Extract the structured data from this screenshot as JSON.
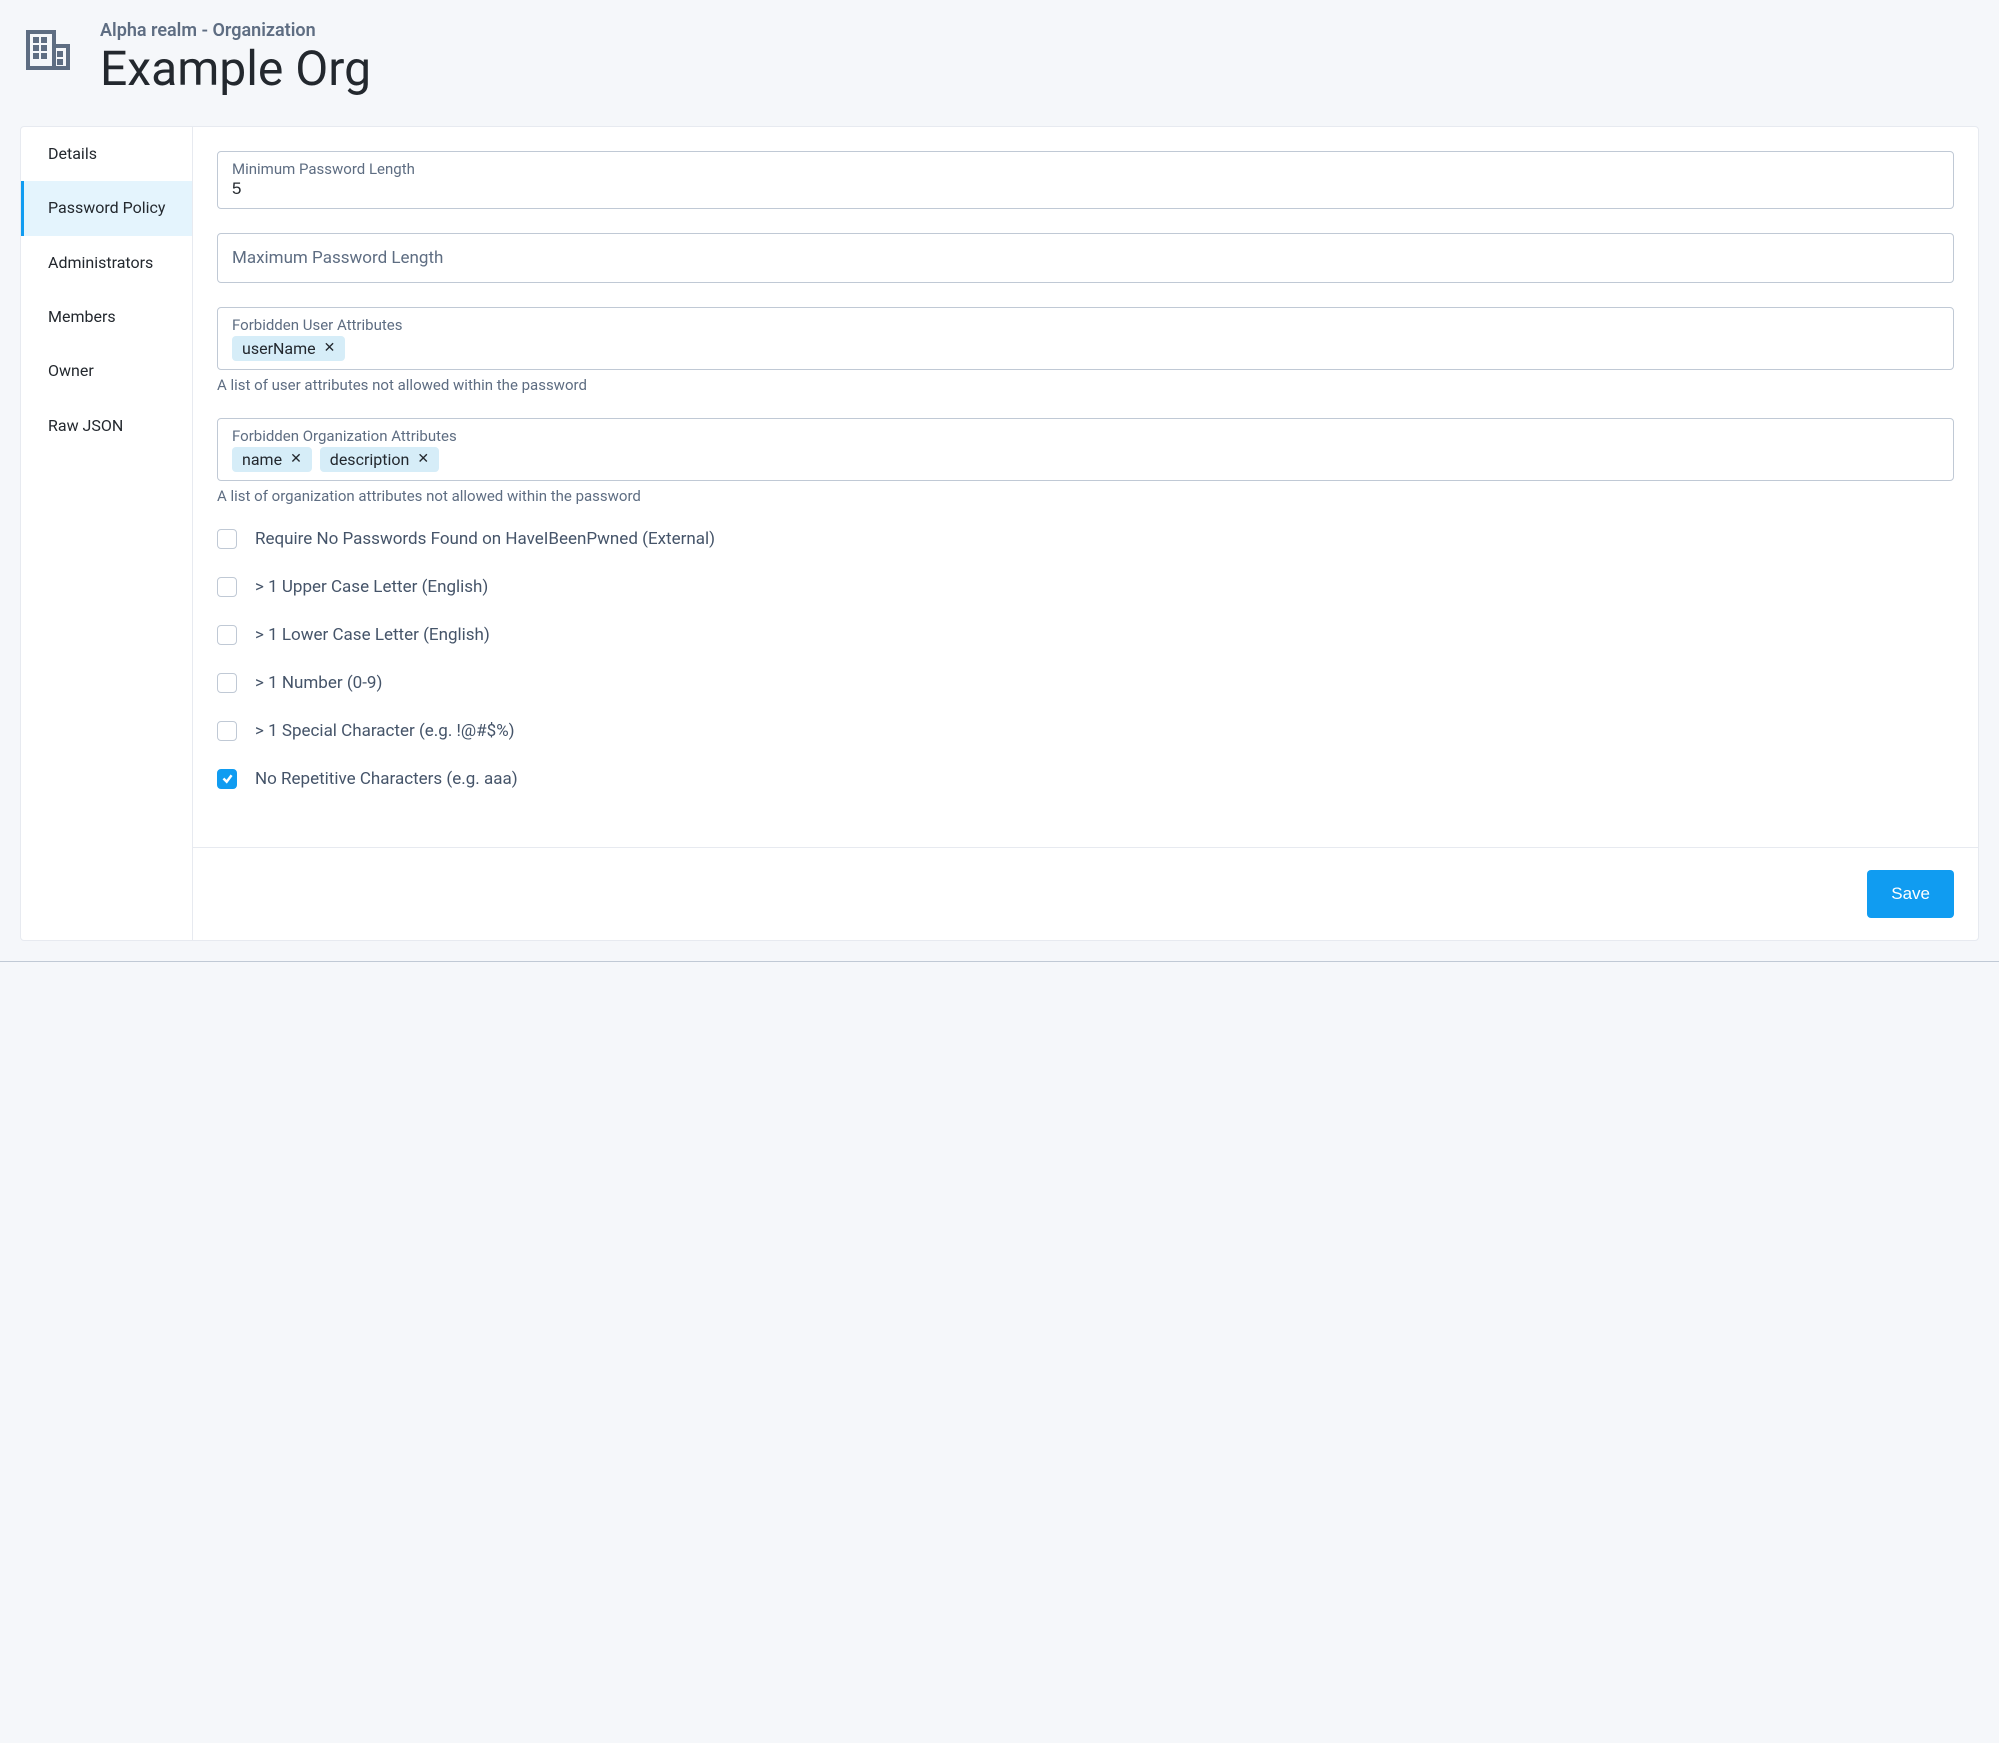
{
  "header": {
    "breadcrumb": "Alpha realm - Organization",
    "title": "Example Org"
  },
  "sidebar": {
    "items": [
      {
        "label": "Details",
        "active": false
      },
      {
        "label": "Password Policy",
        "active": true
      },
      {
        "label": "Administrators",
        "active": false
      },
      {
        "label": "Members",
        "active": false
      },
      {
        "label": "Owner",
        "active": false
      },
      {
        "label": "Raw JSON",
        "active": false
      }
    ]
  },
  "form": {
    "min_length": {
      "label": "Minimum Password Length",
      "value": "5"
    },
    "max_length": {
      "label": "Maximum Password Length",
      "value": ""
    },
    "forbidden_user": {
      "label": "Forbidden User Attributes",
      "tags": [
        "userName"
      ],
      "help": "A list of user attributes not allowed within the password"
    },
    "forbidden_org": {
      "label": "Forbidden Organization Attributes",
      "tags": [
        "name",
        "description"
      ],
      "help": "A list of organization attributes not allowed within the password"
    },
    "checks": [
      {
        "label": "Require No Passwords Found on HaveIBeenPwned (External)",
        "checked": false
      },
      {
        "label": "> 1 Upper Case Letter (English)",
        "checked": false
      },
      {
        "label": "> 1 Lower Case Letter (English)",
        "checked": false
      },
      {
        "label": "> 1 Number (0-9)",
        "checked": false
      },
      {
        "label": "> 1 Special Character (e.g. !@#$%)",
        "checked": false
      },
      {
        "label": "No Repetitive Characters (e.g. aaa)",
        "checked": true
      }
    ]
  },
  "footer": {
    "save": "Save"
  }
}
